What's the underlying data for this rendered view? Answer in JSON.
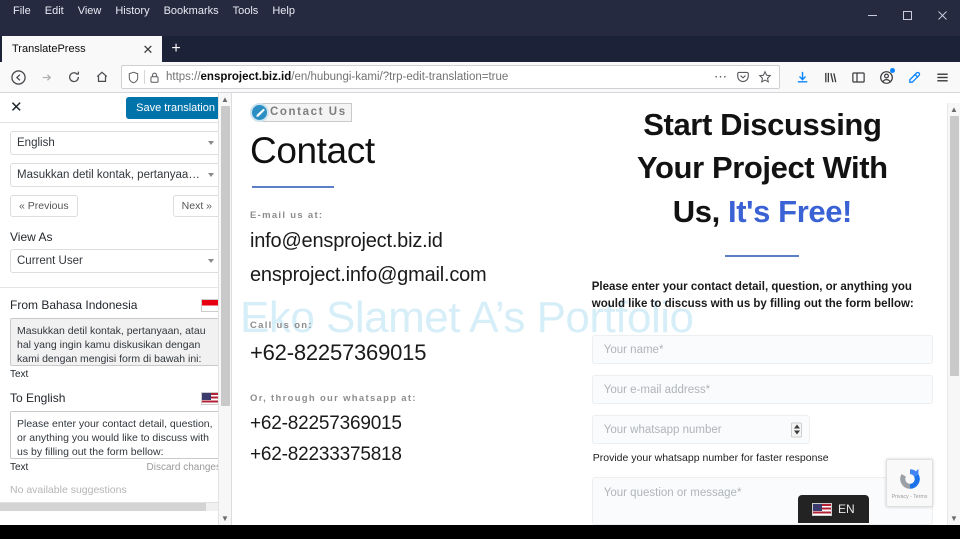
{
  "browser": {
    "menus": [
      "File",
      "Edit",
      "View",
      "History",
      "Bookmarks",
      "Tools",
      "Help"
    ],
    "window_controls": {
      "minimize": "minimize-icon",
      "maximize": "maximize-icon",
      "close": "close-icon"
    },
    "tab": {
      "title": "TranslatePress",
      "close": "✕"
    },
    "newtab_label": "+",
    "url": {
      "scheme": "https://",
      "host": "ensproject.biz.id",
      "path": "/en/hubungi-kami/?trp-edit-translation=true"
    },
    "url_full": "https://ensproject.biz.id/en/hubungi-kami/?trp-edit-translation=true",
    "toolbar_right_icons": [
      "download-icon",
      "library-icon",
      "sidebar-icon",
      "account-icon",
      "eyedropper-icon",
      "hamburger-menu-icon"
    ],
    "url_icons": [
      "shield-icon",
      "lock-icon"
    ],
    "url_right_icons": [
      "page-actions-icon",
      "pocket-icon",
      "bookmark-star-icon"
    ]
  },
  "sidebar": {
    "close_label": "✕",
    "save_label": "Save translation",
    "language_select": "English",
    "string_select": "Masukkan detil kontak, pertanyaan, a...",
    "prev_label": "« Previous",
    "next_label": "Next »",
    "view_as_label": "View As",
    "view_as_value": "Current User",
    "from": {
      "label": "From Bahasa Indonesia",
      "flag": "indonesia-flag",
      "value": "Masukkan detil kontak, pertanyaan, atau hal yang ingin kamu diskusikan dengan kami dengan mengisi form di bawah ini:",
      "type": "Text"
    },
    "to": {
      "label": "To English",
      "flag": "us-flag",
      "value": "Please enter your contact detail, question, or anything you would like to discuss with us by filling out the form bellow:",
      "type": "Text",
      "discard_label": "Discard changes"
    },
    "suggestions": "No available suggestions"
  },
  "page": {
    "watermark": "Eko Slamet A’s Portfolio",
    "eyebrow": "Contact Us",
    "title": "Contact",
    "email_label": "E-mail us at:",
    "emails": [
      "info@ensproject.biz.id",
      "ensproject.info@gmail.com"
    ],
    "call_label": "Call us on:",
    "phone": "+62-82257369015",
    "whatsapp_label": "Or, through our whatsapp at:",
    "whatsapp_numbers": [
      "+62-82257369015",
      "+62-82233375818"
    ],
    "cta_line1": "Start Discussing",
    "cta_line2": "Your Project With",
    "cta_line3_plain": "Us, ",
    "cta_line3_accent": "It's Free!",
    "form_intro": "Please enter your contact detail, question, or anything you would like to discuss with us by filling out the form bellow:",
    "form": {
      "name_placeholder": "Your name*",
      "email_placeholder": "Your e-mail address*",
      "whatsapp_placeholder": "Your whatsapp number",
      "whatsapp_helper": "Provide your whatsapp number for faster response",
      "message_placeholder": "Your question or message*"
    },
    "lang_switcher": {
      "code": "EN",
      "flag": "us-flag"
    },
    "recaptcha": {
      "label": "Privacy - Terms",
      "icon": "recaptcha-icon"
    }
  },
  "colors": {
    "accent_blue": "#3b62d4",
    "rule_blue": "#5b7fc4",
    "save_button": "#0073aa",
    "watermark": "#d6eef8",
    "titlebar": "#252a40"
  }
}
